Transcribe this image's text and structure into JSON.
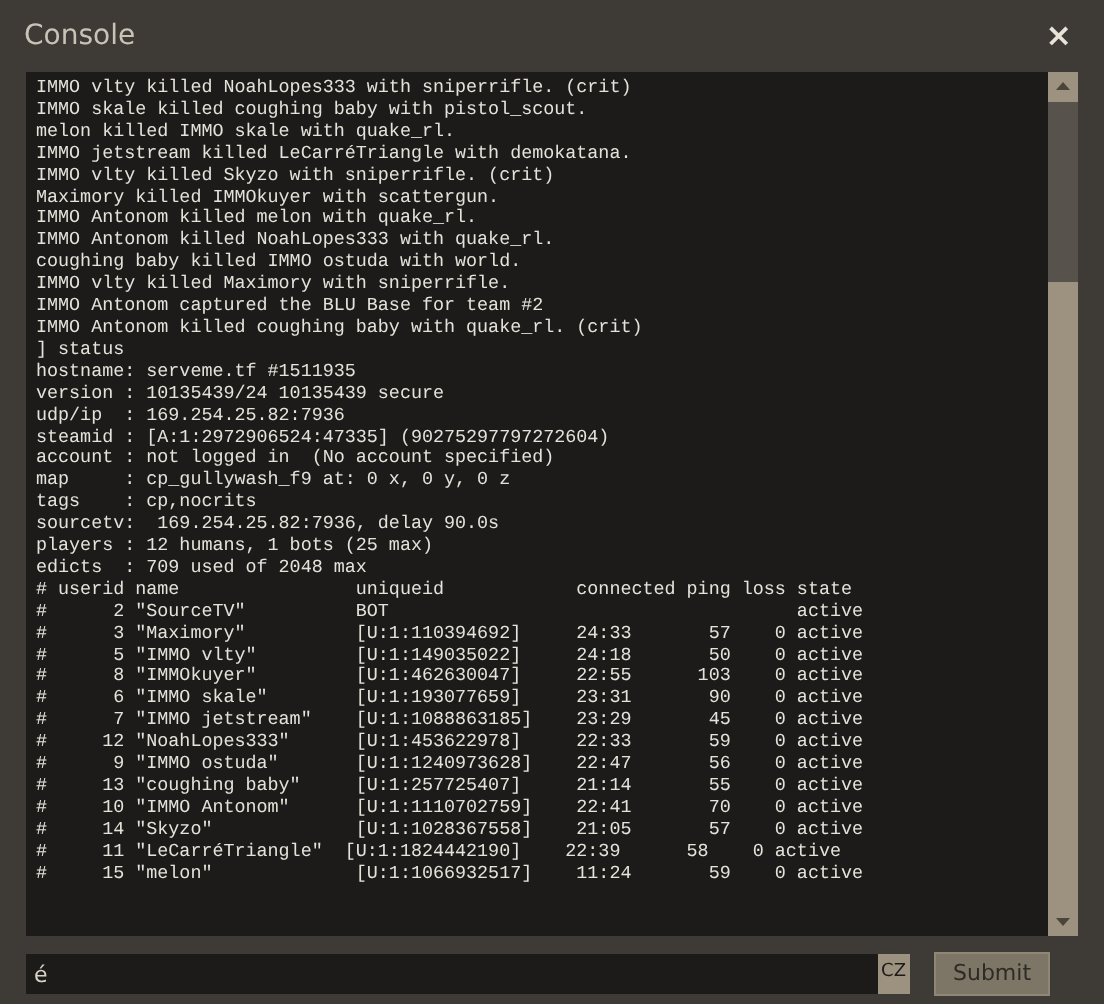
{
  "window": {
    "title": "Console",
    "close": "×"
  },
  "console_lines": [
    "IMMO vlty killed NoahLopes333 with sniperrifle. (crit)",
    "IMMO skale killed coughing baby with pistol_scout.",
    "melon killed IMMO skale with quake_rl.",
    "IMMO jetstream killed LeCarréTriangle with demokatana.",
    "IMMO vlty killed Skyzo with sniperrifle. (crit)",
    "Maximory killed IMMOkuyer with scattergun.",
    "IMMO Antonom killed melon with quake_rl.",
    "IMMO Antonom killed NoahLopes333 with quake_rl.",
    "coughing baby killed IMMO ostuda with world.",
    "IMMO vlty killed Maximory with sniperrifle.",
    "IMMO Antonom captured the BLU Base for team #2",
    "IMMO Antonom killed coughing baby with quake_rl. (crit)",
    "] status",
    "hostname: serveme.tf #1511935",
    "version : 10135439/24 10135439 secure",
    "udp/ip  : 169.254.25.82:7936",
    "steamid : [A:1:2972906524:47335] (90275297797272604)",
    "account : not logged in  (No account specified)",
    "map     : cp_gullywash_f9 at: 0 x, 0 y, 0 z",
    "tags    : cp,nocrits",
    "sourcetv:  169.254.25.82:7936, delay 90.0s",
    "players : 12 humans, 1 bots (25 max)",
    "edicts  : 709 used of 2048 max",
    "# userid name                uniqueid            connected ping loss state",
    "#      2 \"SourceTV\"          BOT                                     active",
    "#      3 \"Maximory\"          [U:1:110394692]     24:33       57    0 active",
    "#      5 \"IMMO vlty\"         [U:1:149035022]     24:18       50    0 active",
    "#      8 \"IMMOkuyer\"         [U:1:462630047]     22:55      103    0 active",
    "#      6 \"IMMO skale\"        [U:1:193077659]     23:31       90    0 active",
    "#      7 \"IMMO jetstream\"    [U:1:1088863185]    23:29       45    0 active",
    "#     12 \"NoahLopes333\"      [U:1:453622978]     22:33       59    0 active",
    "#      9 \"IMMO ostuda\"       [U:1:1240973628]    22:47       56    0 active",
    "#     13 \"coughing baby\"     [U:1:257725407]     21:14       55    0 active",
    "#     10 \"IMMO Antonom\"      [U:1:1110702759]    22:41       70    0 active",
    "#     14 \"Skyzo\"             [U:1:1028367558]    21:05       57    0 active",
    "#     11 \"LeCarréTriangle\"  [U:1:1824442190]    22:39      58    0 active",
    "#     15 \"melon\"             [U:1:1066932517]    11:24       59    0 active"
  ],
  "input": {
    "value": "é",
    "language_badge": "CZ"
  },
  "submit_button": {
    "label": "Submit",
    "disabled": true
  }
}
